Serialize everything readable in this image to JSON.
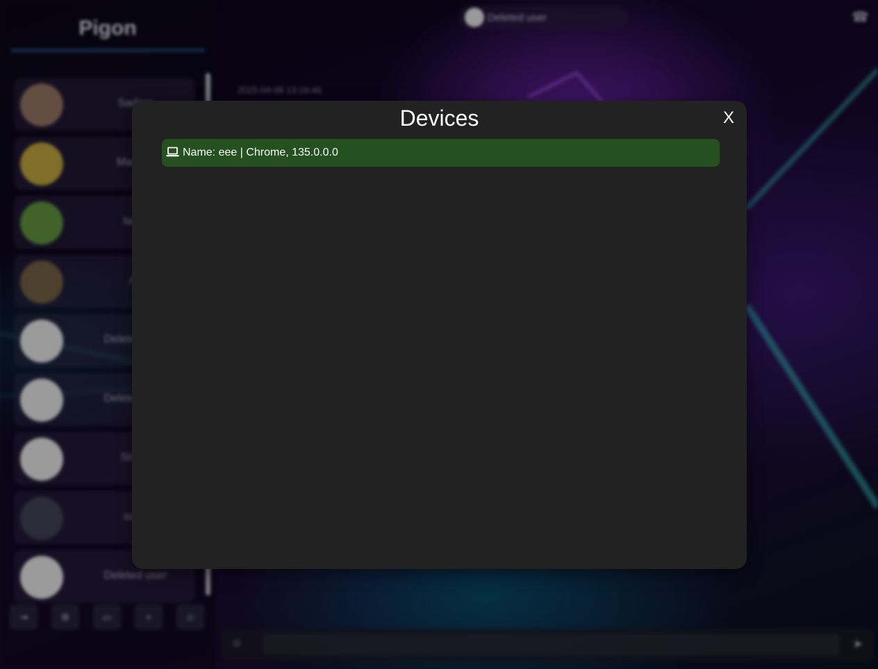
{
  "app": {
    "title": "Pigon"
  },
  "sidebar": {
    "chats": [
      {
        "name": "Sadam"
      },
      {
        "name": "Madara"
      },
      {
        "name": "larsa"
      },
      {
        "name": "Ali"
      },
      {
        "name": "Deleted user"
      },
      {
        "name": "Deleted user"
      },
      {
        "name": "Storm"
      },
      {
        "name": "sami"
      },
      {
        "name": "Deleted user"
      }
    ],
    "toolbar_icons": [
      "logout-icon",
      "settings-icon",
      "chat-icon",
      "plus-icon",
      "contacts-icon"
    ]
  },
  "chat_header": {
    "name": "Deleted user"
  },
  "messages": {
    "timestamp": "2025-04-08 13:16:46"
  },
  "modal": {
    "title": "Devices",
    "close_label": "X",
    "devices": [
      {
        "label": "Name: eee | Chrome, 135.0.0.0",
        "icon": "laptop-icon",
        "current": true
      }
    ]
  },
  "colors": {
    "modal_background": "#222222",
    "current_device_background": "#24511f",
    "text": "#ffffff"
  }
}
